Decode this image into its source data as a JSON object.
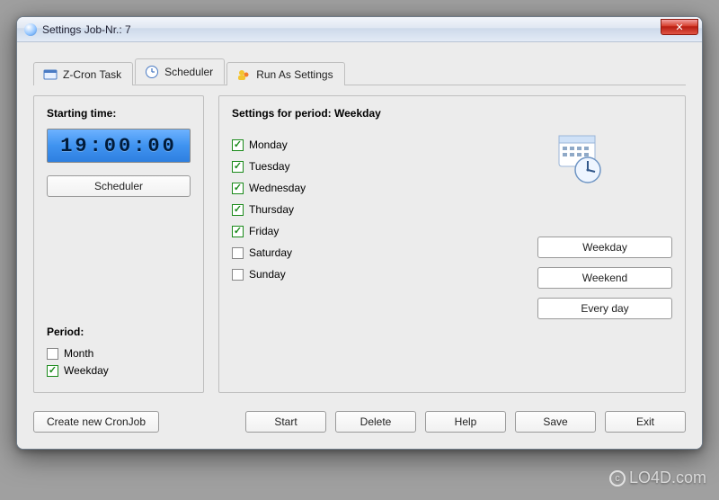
{
  "window": {
    "title": "Settings Job-Nr.: 7",
    "close_label": "✕"
  },
  "tabs": [
    {
      "label": "Z-Cron Task",
      "icon": "task"
    },
    {
      "label": "Scheduler",
      "icon": "clock"
    },
    {
      "label": "Run As Settings",
      "icon": "users"
    }
  ],
  "active_tab": 1,
  "starting_time": {
    "heading": "Starting time:",
    "value": "19:00:00",
    "scheduler_button": "Scheduler"
  },
  "period": {
    "heading": "Period:",
    "options": [
      {
        "label": "Month",
        "checked": false
      },
      {
        "label": "Weekday",
        "checked": true
      }
    ]
  },
  "settings": {
    "heading": "Settings for period: Weekday",
    "days": [
      {
        "label": "Monday",
        "checked": true
      },
      {
        "label": "Tuesday",
        "checked": true
      },
      {
        "label": "Wednesday",
        "checked": true
      },
      {
        "label": "Thursday",
        "checked": true
      },
      {
        "label": "Friday",
        "checked": true
      },
      {
        "label": "Saturday",
        "checked": false
      },
      {
        "label": "Sunday",
        "checked": false
      }
    ],
    "presets": [
      {
        "label": "Weekday"
      },
      {
        "label": "Weekend"
      },
      {
        "label": "Every day"
      }
    ]
  },
  "buttons": {
    "create": "Create new CronJob",
    "start": "Start",
    "delete": "Delete",
    "help": "Help",
    "save": "Save",
    "exit": "Exit"
  },
  "watermark": "LO4D.com"
}
